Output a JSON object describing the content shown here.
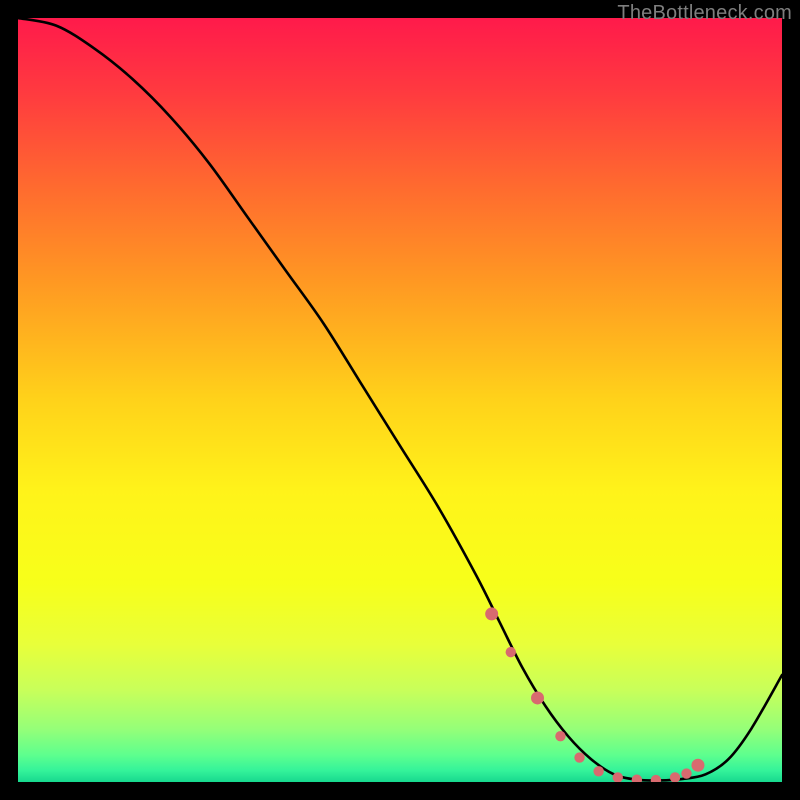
{
  "watermark": "TheBottleneck.com",
  "gradient": {
    "stops": [
      {
        "offset": 0.0,
        "color": "#ff1a4b"
      },
      {
        "offset": 0.1,
        "color": "#ff3b3f"
      },
      {
        "offset": 0.22,
        "color": "#ff6a2f"
      },
      {
        "offset": 0.35,
        "color": "#ff9a22"
      },
      {
        "offset": 0.5,
        "color": "#ffd21a"
      },
      {
        "offset": 0.62,
        "color": "#fff31a"
      },
      {
        "offset": 0.74,
        "color": "#f7ff1a"
      },
      {
        "offset": 0.82,
        "color": "#e8ff3a"
      },
      {
        "offset": 0.88,
        "color": "#c8ff5a"
      },
      {
        "offset": 0.93,
        "color": "#96ff78"
      },
      {
        "offset": 0.965,
        "color": "#5dff8e"
      },
      {
        "offset": 0.985,
        "color": "#34f39a"
      },
      {
        "offset": 1.0,
        "color": "#17d88f"
      }
    ]
  },
  "chart_data": {
    "type": "line",
    "title": "",
    "xlabel": "",
    "ylabel": "",
    "xlim": [
      0,
      100
    ],
    "ylim": [
      0,
      100
    ],
    "series": [
      {
        "name": "bottleneck-curve",
        "x": [
          0,
          5,
          10,
          15,
          20,
          25,
          30,
          35,
          40,
          45,
          50,
          55,
          60,
          63,
          66,
          69,
          72,
          75,
          78,
          81,
          84,
          87,
          90,
          93,
          96,
          100
        ],
        "values": [
          100,
          99,
          96,
          92,
          87,
          81,
          74,
          67,
          60,
          52,
          44,
          36,
          27,
          21,
          15,
          10,
          6,
          3,
          1,
          0.3,
          0.2,
          0.4,
          1,
          3,
          7,
          14
        ]
      }
    ],
    "markers": {
      "name": "highlighted-points",
      "color": "#d86a6f",
      "x": [
        62,
        64.5,
        68,
        71,
        73.5,
        76,
        78.5,
        81,
        83.5,
        86,
        87.5,
        89
      ],
      "values": [
        22,
        17,
        11,
        6,
        3.2,
        1.4,
        0.6,
        0.3,
        0.25,
        0.6,
        1.1,
        2.2
      ]
    }
  }
}
